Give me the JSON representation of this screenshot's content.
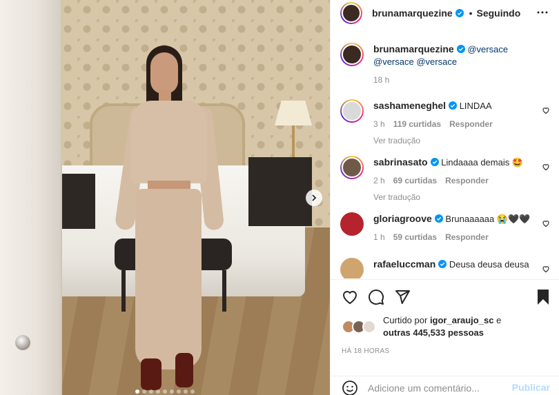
{
  "post": {
    "photo_alt": "",
    "carousel_dots": 9,
    "carousel_active": 0
  },
  "header": {
    "username": "brunamarquezine",
    "separator": "•",
    "follow_state": "Seguindo",
    "more_icon": "more-horizontal-icon"
  },
  "caption": {
    "username": "brunamarquezine",
    "mentions_line1": "@versace",
    "mentions_line2": "@versace @versace",
    "time": "18 h"
  },
  "comments": [
    {
      "username": "sashameneghel",
      "text": "LINDAA",
      "time": "3 h",
      "likes": "119 curtidas",
      "reply": "Responder",
      "translate": "Ver tradução",
      "avatar_color": "#d9d9d9"
    },
    {
      "username": "sabrinasato",
      "text": "Lindaaaa demais 🤩",
      "time": "2 h",
      "likes": "69 curtidas",
      "reply": "Responder",
      "translate": "Ver tradução",
      "avatar_color": "#6f5a4a"
    },
    {
      "username": "gloriagroove",
      "text": "Brunaaaaaa 😭🖤🖤",
      "time": "1 h",
      "likes": "59 curtidas",
      "reply": "Responder",
      "translate": "",
      "avatar_color": "#b5232d"
    },
    {
      "username": "rafaeluccman",
      "text": "Deusa deusa deusa",
      "time": "",
      "likes": "",
      "reply": "",
      "translate": "",
      "avatar_color": "#cfa46f"
    }
  ],
  "likes": {
    "prefix": "Curtido por",
    "user": "igor_araujo_sc",
    "suffix": "e",
    "others": "outras 445,533 pessoas"
  },
  "timestamp": "HÁ 18 HORAS",
  "add_comment": {
    "placeholder": "Adicione um comentário...",
    "publish": "Publicar"
  },
  "colors": {
    "verified": "#0095f6",
    "link": "#00376b",
    "muted": "#8e8e8e",
    "publish_disabled": "#b3dbff"
  }
}
